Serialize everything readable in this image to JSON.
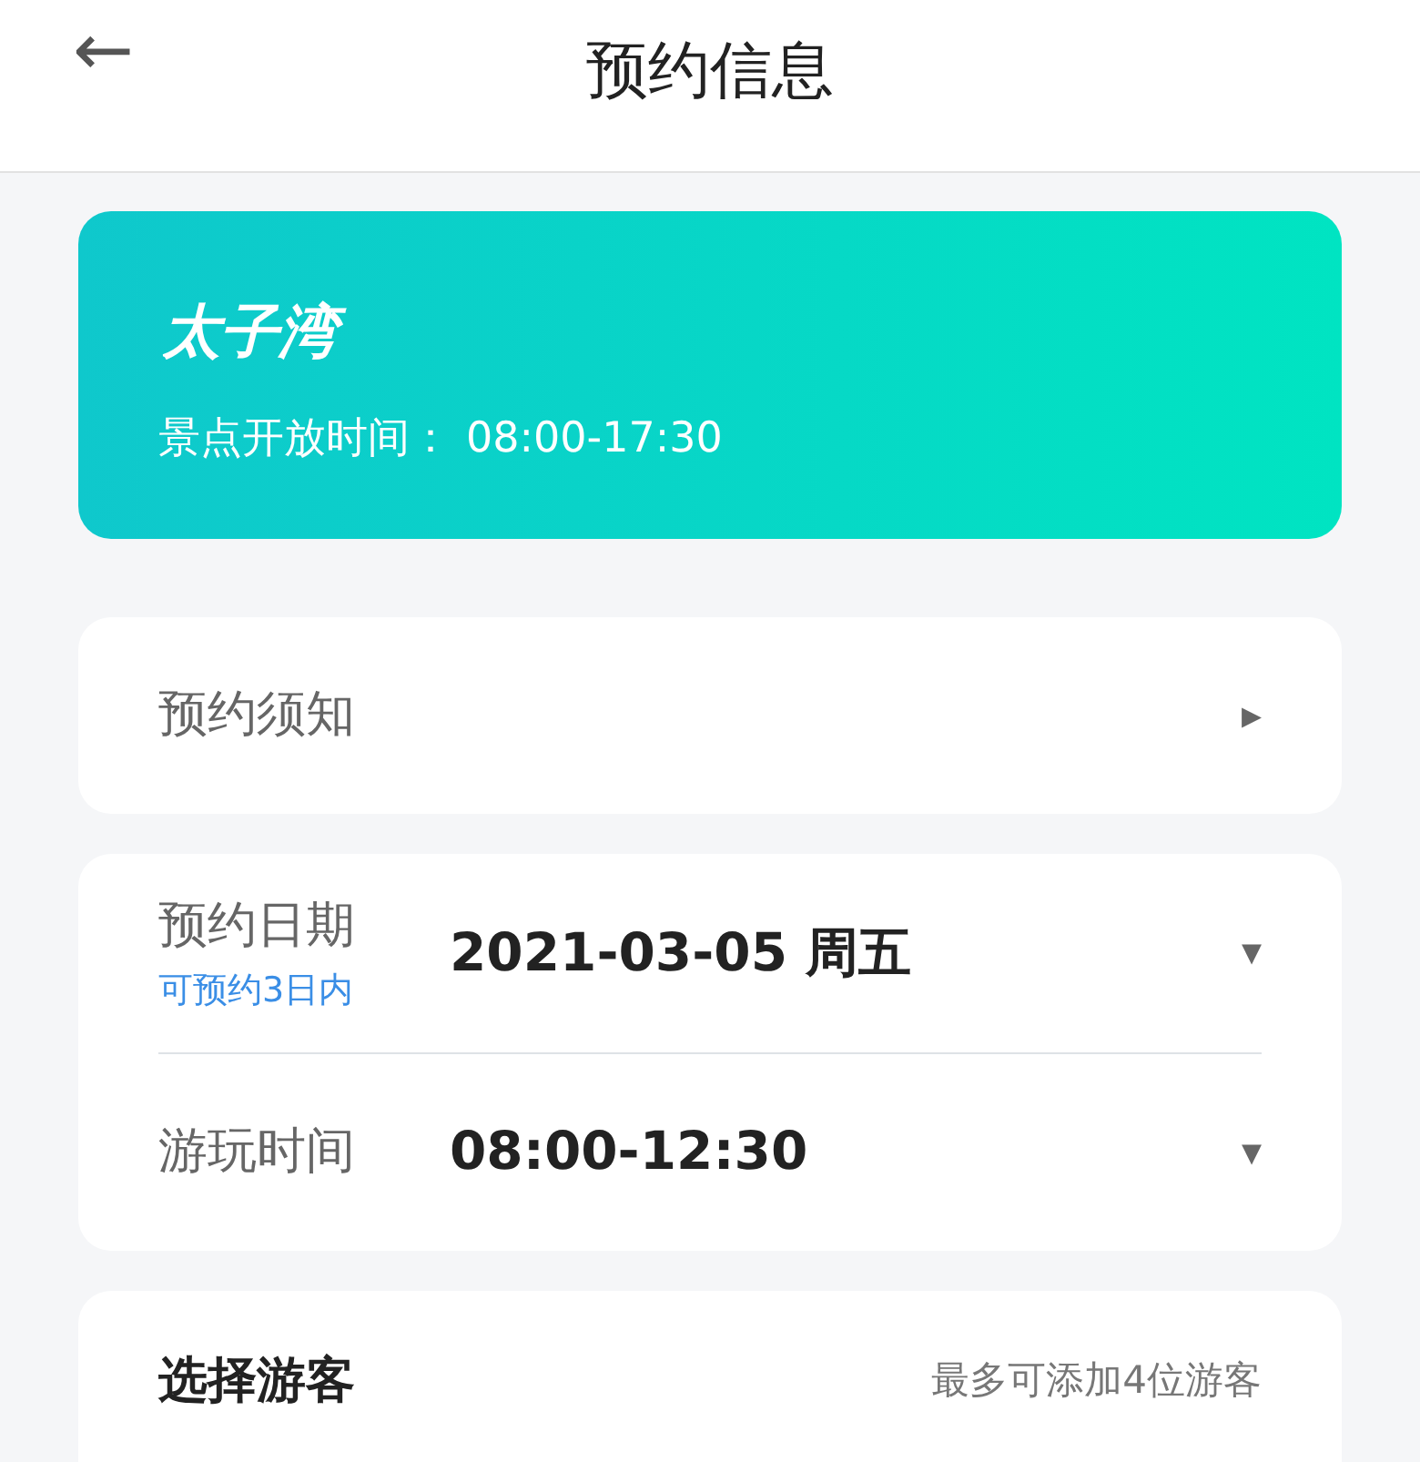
{
  "header": {
    "back": "←",
    "title": "预约信息"
  },
  "banner": {
    "name": "太子湾",
    "hours_label": "景点开放时间：",
    "hours": "08:00-17:30"
  },
  "notice": {
    "label": "预约须知",
    "arrow": "▸"
  },
  "booking": [
    {
      "kind": "date",
      "label": "预约日期",
      "hint": "可预约3日内",
      "value": "2021-03-05 周五",
      "caret": "▾"
    },
    {
      "kind": "time",
      "label": "游玩时间",
      "value": "08:00-12:30",
      "caret": "▾"
    }
  ],
  "visitors": {
    "title": "选择游客",
    "note": "最多可添加4位游客"
  }
}
